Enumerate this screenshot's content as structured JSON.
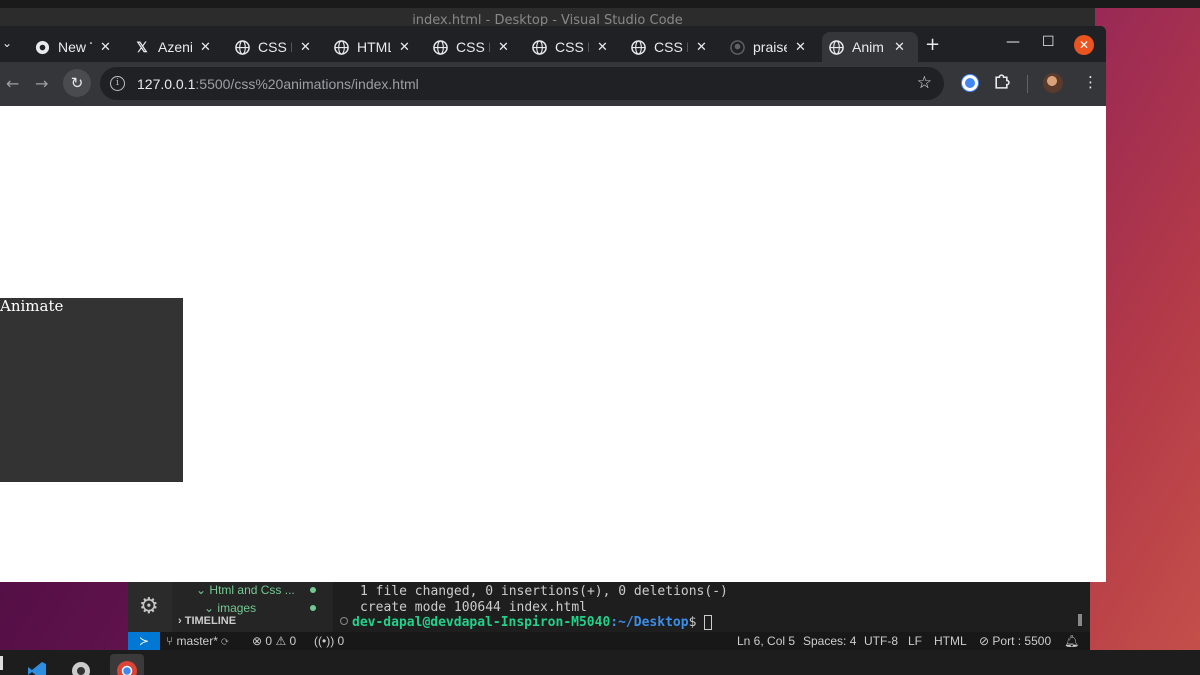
{
  "vscode": {
    "window_title": "index.html - Desktop - Visual Studio Code",
    "explorer": {
      "folder_label": "Html and Css ...",
      "subfolder_label": "images",
      "timeline_label": "TIMELINE"
    },
    "terminal": {
      "line1": "1 file changed, 0 insertions(+), 0 deletions(-)",
      "line2": "create mode 100644 index.html",
      "prompt_user": "dev-dapal@devdapal-Inspiron-M5040",
      "prompt_path": ":~/Desktop",
      "prompt_end": "$ "
    },
    "status": {
      "branch": "master*",
      "errors": "0",
      "warnings": "0",
      "ports_count": "0",
      "position": "Ln 6, Col 5",
      "spaces": "Spaces: 4",
      "encoding": "UTF-8",
      "eol": "LF",
      "language": "HTML",
      "port": "Port : 5500"
    }
  },
  "chrome": {
    "tabs": [
      {
        "label": "New T",
        "icon": "chrome-icon"
      },
      {
        "label": "Azeni",
        "icon": "x-logo-icon"
      },
      {
        "label": "CSS E",
        "icon": "globe-icon"
      },
      {
        "label": "HTML",
        "icon": "globe-icon"
      },
      {
        "label": "CSS E",
        "icon": "globe-icon"
      },
      {
        "label": "CSS E",
        "icon": "globe-icon"
      },
      {
        "label": "CSS E",
        "icon": "globe-icon"
      },
      {
        "label": "praise",
        "icon": "github-icon"
      },
      {
        "label": "Anim",
        "icon": "globe-icon",
        "active": true
      }
    ],
    "url": {
      "host": "127.0.0.1",
      "path": ":5500/css%20animations/index.html"
    }
  },
  "page": {
    "box_text": "Animate",
    "box_color": "#333333"
  },
  "colors": {
    "ubuntu_orange": "#e95420",
    "vscode_blue": "#0078d4",
    "terminal_green": "#23d18b",
    "terminal_blue": "#3b8eea"
  }
}
